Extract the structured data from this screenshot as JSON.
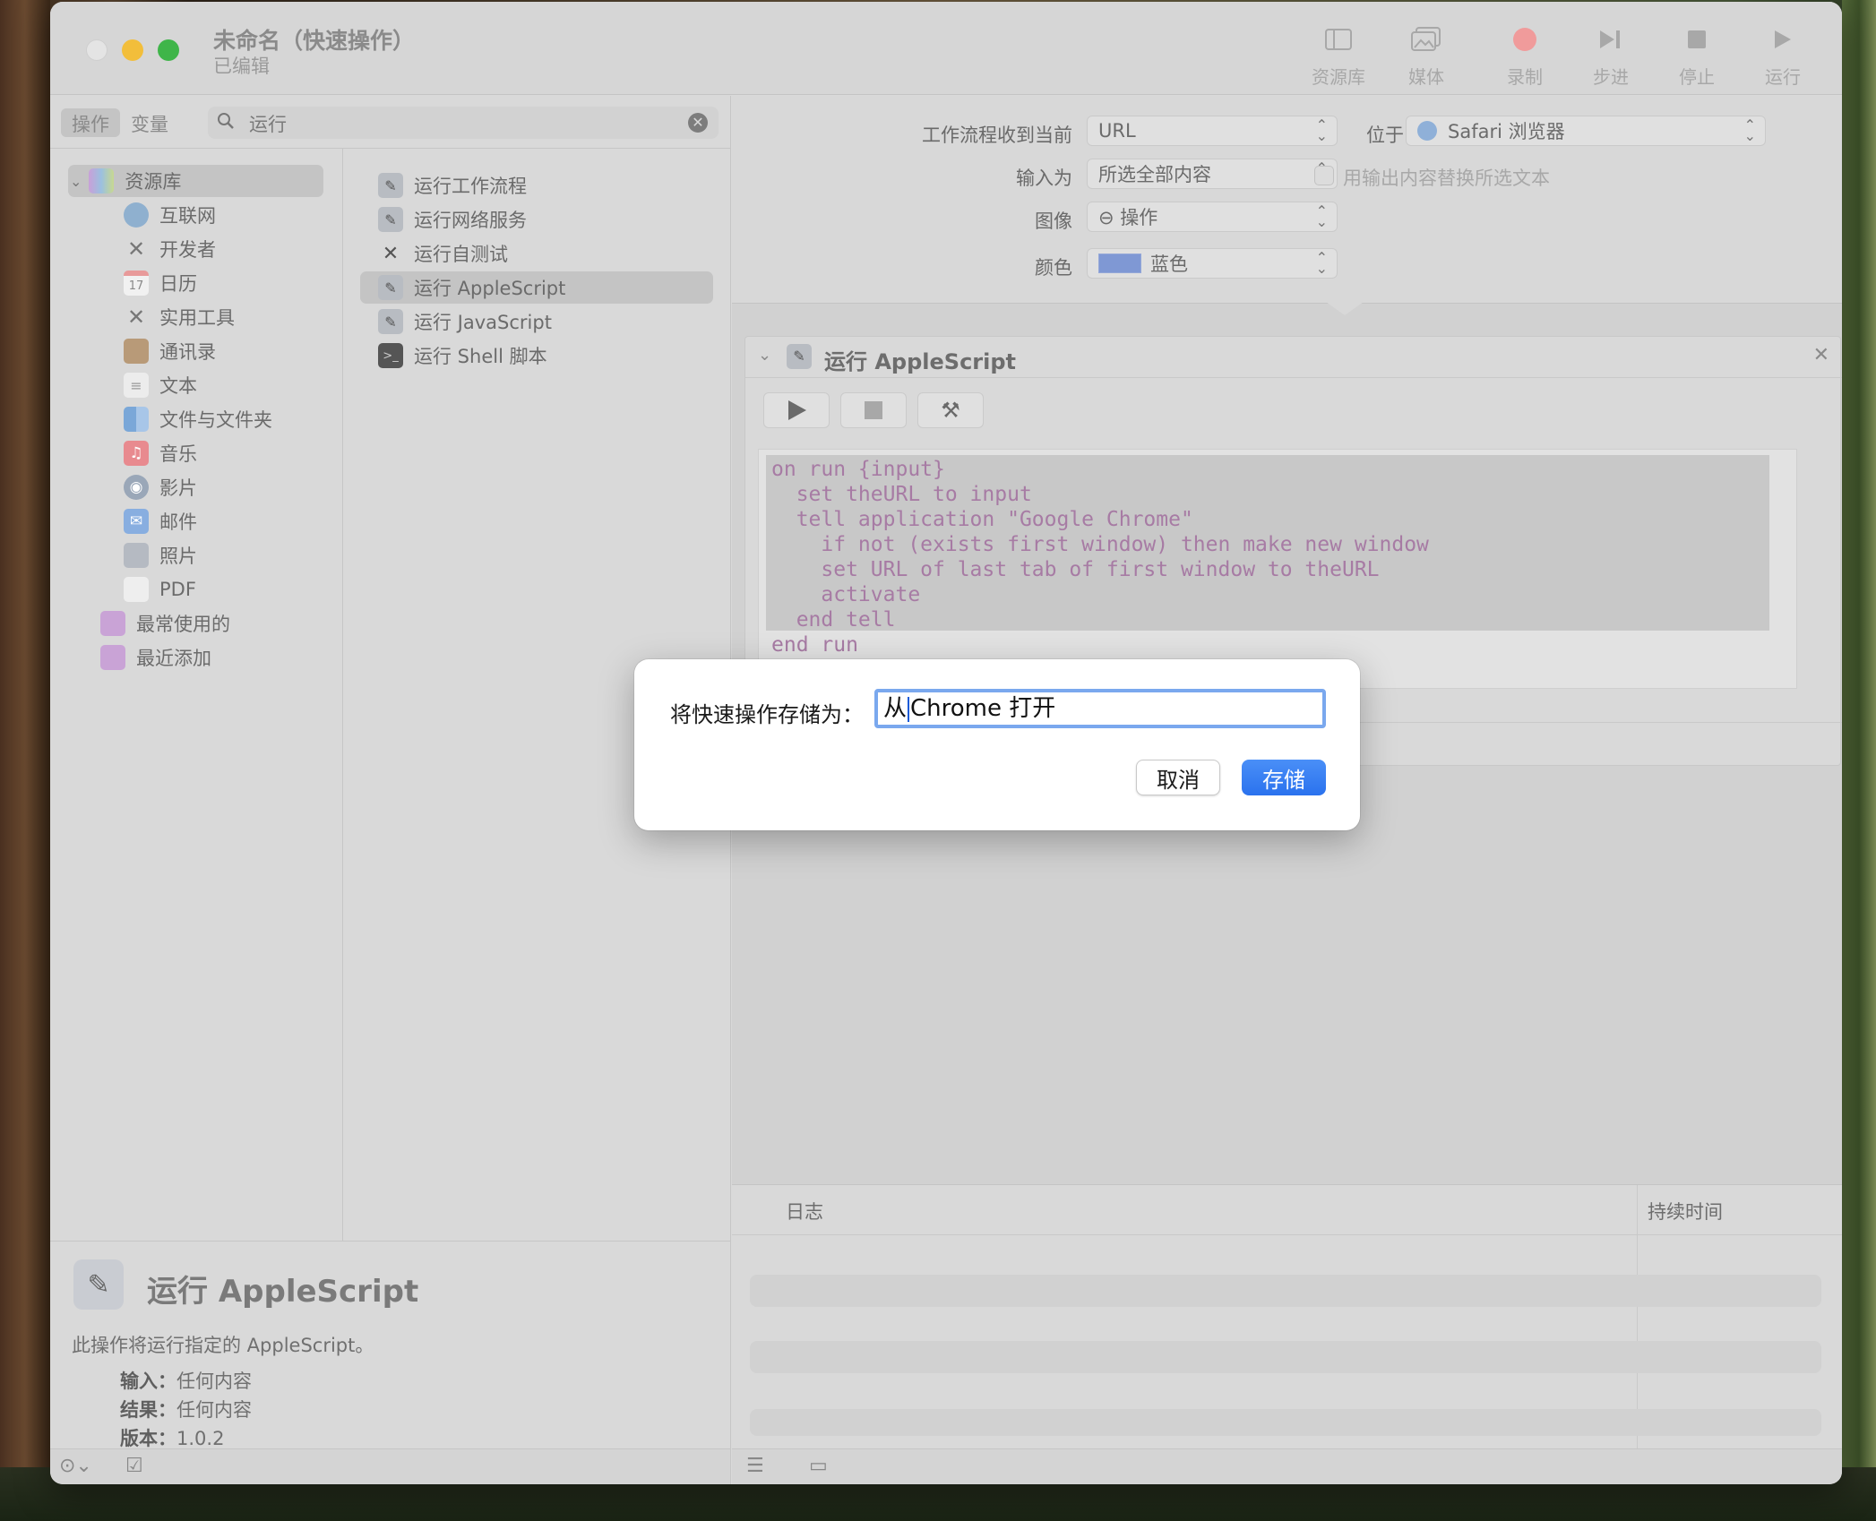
{
  "window": {
    "title": "未命名（快速操作）",
    "subtitle": "已编辑"
  },
  "toolbar": {
    "library": "资源库",
    "media": "媒体",
    "record": "录制",
    "step": "步进",
    "stop": "停止",
    "run": "运行",
    "record_color": "#f0a0a0"
  },
  "sidebar": {
    "tabs": [
      "操作",
      "变量"
    ],
    "search_value": "运行",
    "categories": [
      {
        "label": "资源库",
        "icon": "library-icon"
      },
      {
        "label": "互联网",
        "icon": "globe-icon"
      },
      {
        "label": "开发者",
        "icon": "tools-icon"
      },
      {
        "label": "日历",
        "icon": "calendar-icon"
      },
      {
        "label": "实用工具",
        "icon": "tools-icon"
      },
      {
        "label": "通讯录",
        "icon": "contacts-icon"
      },
      {
        "label": "文本",
        "icon": "text-icon"
      },
      {
        "label": "文件与文件夹",
        "icon": "finder-icon"
      },
      {
        "label": "音乐",
        "icon": "music-icon"
      },
      {
        "label": "影片",
        "icon": "movie-icon"
      },
      {
        "label": "邮件",
        "icon": "mail-icon"
      },
      {
        "label": "照片",
        "icon": "photo-icon"
      },
      {
        "label": "PDF",
        "icon": "pdf-icon"
      },
      {
        "label": "最常使用的",
        "icon": "smart-folder-icon"
      },
      {
        "label": "最近添加",
        "icon": "smart-folder-icon"
      }
    ],
    "actions": [
      "运行工作流程",
      "运行网络服务",
      "运行自测试",
      "运行 AppleScript",
      "运行 JavaScript",
      "运行 Shell 脚本"
    ]
  },
  "description": {
    "title": "运行 AppleScript",
    "text": "此操作将运行指定的 AppleScript。",
    "input_label": "输入：",
    "input_value": "任何内容",
    "result_label": "结果：",
    "result_value": "任何内容",
    "version_label": "版本：",
    "version_value": "1.0.2"
  },
  "workflow": {
    "receives_label": "工作流程收到当前",
    "receives_value": "URL",
    "in_label": "位于",
    "in_value": "Safari 浏览器",
    "input_is_label": "输入为",
    "input_is_value": "所选全部内容",
    "replace_label": "用输出内容替换所选文本",
    "image_label": "图像",
    "image_value": "⊖ 操作",
    "color_label": "颜色",
    "color_value": "蓝色",
    "swatch_color": "#7f98d4"
  },
  "action": {
    "title": "运行 AppleScript",
    "code": "on run {input}\n  set theURL to input\n  tell application \"Google Chrome\"\n    if not (exists first window) then make new window\n    set URL of last tab of first window to theURL\n    activate\n  end tell\nend run"
  },
  "log": {
    "col_log": "日志",
    "col_duration": "持续时间"
  },
  "dialog": {
    "label": "将快速操作存储为：",
    "value_before": "从",
    "value_after": "Chrome 打开",
    "cancel": "取消",
    "save": "存储"
  }
}
